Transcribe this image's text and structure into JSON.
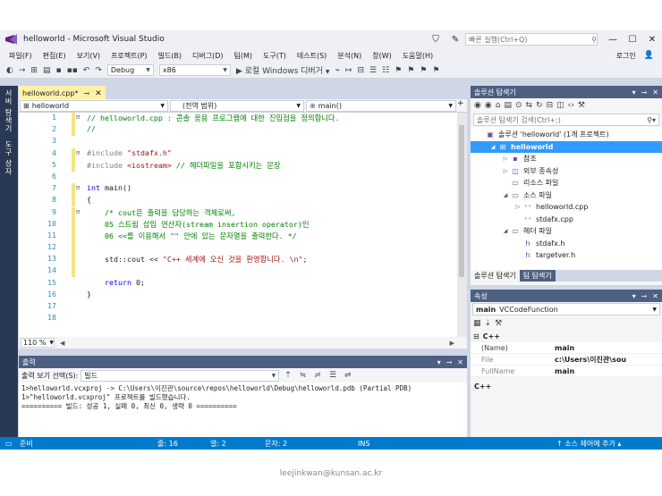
{
  "window": {
    "title": "helloworld - Microsoft Visual Studio",
    "quick_launch_placeholder": "빠른 실행(Ctrl+Q)",
    "login": "로그인"
  },
  "menu": [
    "파일(F)",
    "편집(E)",
    "보기(V)",
    "프로젝트(P)",
    "빌드(B)",
    "디버그(D)",
    "팀(M)",
    "도구(T)",
    "테스트(S)",
    "분석(N)",
    "창(W)",
    "도움말(H)"
  ],
  "toolbar": {
    "config": "Debug",
    "platform": "x86",
    "run_label": "▶ 로컬 Windows 디버거"
  },
  "left_tabs": [
    "서버 탐색기",
    "도구 상자"
  ],
  "editor": {
    "tab_label": "helloworld.cpp*",
    "nav_scope": "helloworld",
    "nav_global": "(전역 범위)",
    "nav_member": "main()",
    "zoom": "110 %",
    "lines": [
      {
        "n": "1",
        "fold": "⊟",
        "changed": true,
        "parts": [
          {
            "t": "// helloworld.cpp : 콘솔 응용 프로그램에 대한 진입점을 정의합니다.",
            "c": "cmt"
          }
        ]
      },
      {
        "n": "2",
        "fold": "",
        "changed": true,
        "parts": [
          {
            "t": "//",
            "c": "cmt"
          }
        ]
      },
      {
        "n": "3",
        "fold": "",
        "changed": false,
        "parts": []
      },
      {
        "n": "4",
        "fold": "⊟",
        "changed": true,
        "parts": [
          {
            "t": "#include ",
            "c": "pp"
          },
          {
            "t": "\"stdafx.h\"",
            "c": "str"
          }
        ]
      },
      {
        "n": "5",
        "fold": "",
        "changed": true,
        "parts": [
          {
            "t": "#include ",
            "c": "pp"
          },
          {
            "t": "<iostream>",
            "c": "str"
          },
          {
            "t": " // 헤더파일을 포함시키는 문장",
            "c": "cmt"
          }
        ]
      },
      {
        "n": "6",
        "fold": "",
        "changed": false,
        "parts": []
      },
      {
        "n": "7",
        "fold": "⊟",
        "changed": true,
        "parts": [
          {
            "t": "int",
            "c": "kw"
          },
          {
            "t": " main()",
            "c": ""
          }
        ]
      },
      {
        "n": "8",
        "fold": "",
        "changed": true,
        "parts": [
          {
            "t": "{",
            "c": ""
          }
        ]
      },
      {
        "n": "9",
        "fold": "⊟",
        "changed": true,
        "parts": [
          {
            "t": "    /* cout은 출력을 담당하는 객체로써,",
            "c": "cmt"
          }
        ]
      },
      {
        "n": "10",
        "fold": "",
        "changed": true,
        "parts": [
          {
            "t": "    05 스트림 삽입 연산자(stream insertion operator)인",
            "c": "cmt"
          }
        ]
      },
      {
        "n": "11",
        "fold": "",
        "changed": true,
        "parts": [
          {
            "t": "    06 <<를 이용해서 \"\" 안에 있는 문자열을 출력한다. */",
            "c": "cmt"
          }
        ]
      },
      {
        "n": "12",
        "fold": "",
        "changed": true,
        "parts": []
      },
      {
        "n": "13",
        "fold": "",
        "changed": true,
        "parts": [
          {
            "t": "    std::cout << ",
            "c": ""
          },
          {
            "t": "\"C++ 세계에 오신 것을 환영합니다. \\n\"",
            "c": "str"
          },
          {
            "t": ";",
            "c": ""
          }
        ]
      },
      {
        "n": "14",
        "fold": "",
        "changed": true,
        "parts": []
      },
      {
        "n": "15",
        "fold": "",
        "changed": false,
        "parts": [
          {
            "t": "    ",
            "c": ""
          },
          {
            "t": "return",
            "c": "kw"
          },
          {
            "t": " 0;",
            "c": ""
          }
        ]
      },
      {
        "n": "16",
        "fold": "",
        "changed": false,
        "parts": [
          {
            "t": "}",
            "c": ""
          }
        ]
      },
      {
        "n": "17",
        "fold": "",
        "changed": false,
        "parts": []
      },
      {
        "n": "18",
        "fold": "",
        "changed": false,
        "parts": []
      }
    ]
  },
  "output": {
    "title": "출력",
    "source_label": "출력 보기 선택(S):",
    "source_value": "빌드",
    "lines": [
      "1>helloworld.vcxproj -> C:\\Users\\이진관\\source\\repos\\helloworld\\Debug\\helloworld.pdb (Partial PDB)",
      "1>\"helloworld.vcxproj\" 프로젝트를 빌드했습니다.",
      "========== 빌드: 성공 1, 실패 0, 최신 0, 생략 0 =========="
    ]
  },
  "solution": {
    "title": "솔루션 탐색기",
    "search_placeholder": "솔루션 탐색기 검색(Ctrl+;)",
    "items": [
      {
        "label": "솔루션 'helloworld' (1개 프로젝트)",
        "indent": 0,
        "arrow": "",
        "icon": "solution-icon",
        "glyph": "▣",
        "selected": false
      },
      {
        "label": "helloworld",
        "indent": 1,
        "arrow": "◢",
        "icon": "project-icon",
        "glyph": "⊞",
        "selected": true
      },
      {
        "label": "참조",
        "indent": 2,
        "arrow": "▷",
        "icon": "references-icon",
        "glyph": "▪",
        "selected": false
      },
      {
        "label": "외부 종속성",
        "indent": 2,
        "arrow": "▷",
        "icon": "dependencies-icon",
        "glyph": "◫",
        "selected": false
      },
      {
        "label": "리소스 파일",
        "indent": 2,
        "arrow": "",
        "icon": "folder-icon",
        "glyph": "▭",
        "selected": false
      },
      {
        "label": "소스 파일",
        "indent": 2,
        "arrow": "◢",
        "icon": "folder-open-icon",
        "glyph": "▭",
        "selected": false
      },
      {
        "label": "helloworld.cpp",
        "indent": 3,
        "arrow": "▷",
        "icon": "cpp-file-icon",
        "glyph": "⁺⁺",
        "selected": false
      },
      {
        "label": "stdafx.cpp",
        "indent": 3,
        "arrow": "",
        "icon": "cpp-file-icon",
        "glyph": "⁺⁺",
        "selected": false
      },
      {
        "label": "헤더 파일",
        "indent": 2,
        "arrow": "◢",
        "icon": "folder-open-icon",
        "glyph": "▭",
        "selected": false
      },
      {
        "label": "stdafx.h",
        "indent": 3,
        "arrow": "",
        "icon": "header-file-icon",
        "glyph": "h",
        "selected": false
      },
      {
        "label": "targetver.h",
        "indent": 3,
        "arrow": "",
        "icon": "header-file-icon",
        "glyph": "h",
        "selected": false
      }
    ],
    "tab_solution": "솔루션 탐색기",
    "tab_team": "팀 탐색기"
  },
  "properties": {
    "title": "속성",
    "selected_name": "main",
    "selected_type": "VCCodeFunction",
    "category": "C++",
    "rows": [
      {
        "k": "(Name)",
        "v": "main",
        "bold": true,
        "dim": false
      },
      {
        "k": "File",
        "v": "c:\\Users\\이진관\\sou",
        "bold": true,
        "dim": true
      },
      {
        "k": "FullName",
        "v": "main",
        "bold": true,
        "dim": true
      }
    ],
    "description": "C++"
  },
  "status": {
    "ready": "준비",
    "line": "줄: 16",
    "col": "열: 2",
    "char": "문자: 2",
    "ins": "INS",
    "source_control": "↑  소스 제어에 추가 ▴"
  },
  "footer": {
    "email": "leejinkwan@kunsan.ac.kr"
  }
}
